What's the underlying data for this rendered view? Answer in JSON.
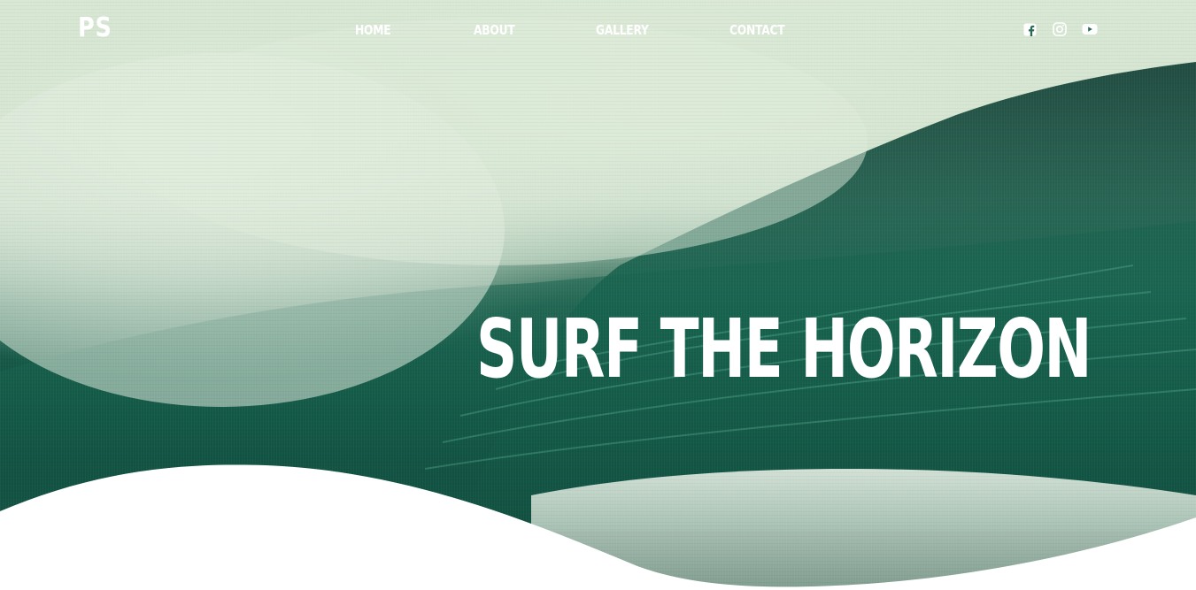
{
  "brand": {
    "logo_text": "PS"
  },
  "nav": {
    "items": [
      {
        "label": "HOME"
      },
      {
        "label": "ABOUT"
      },
      {
        "label": "GALLERY"
      },
      {
        "label": "CONTACT"
      }
    ]
  },
  "social": {
    "icons": [
      "facebook-icon",
      "instagram-icon",
      "youtube-icon"
    ]
  },
  "hero": {
    "headline": "SURF THE HORIZON",
    "colors": {
      "deep_green": "#0f4d3d",
      "spray": "#d9e8d5",
      "text": "#ffffff"
    }
  }
}
